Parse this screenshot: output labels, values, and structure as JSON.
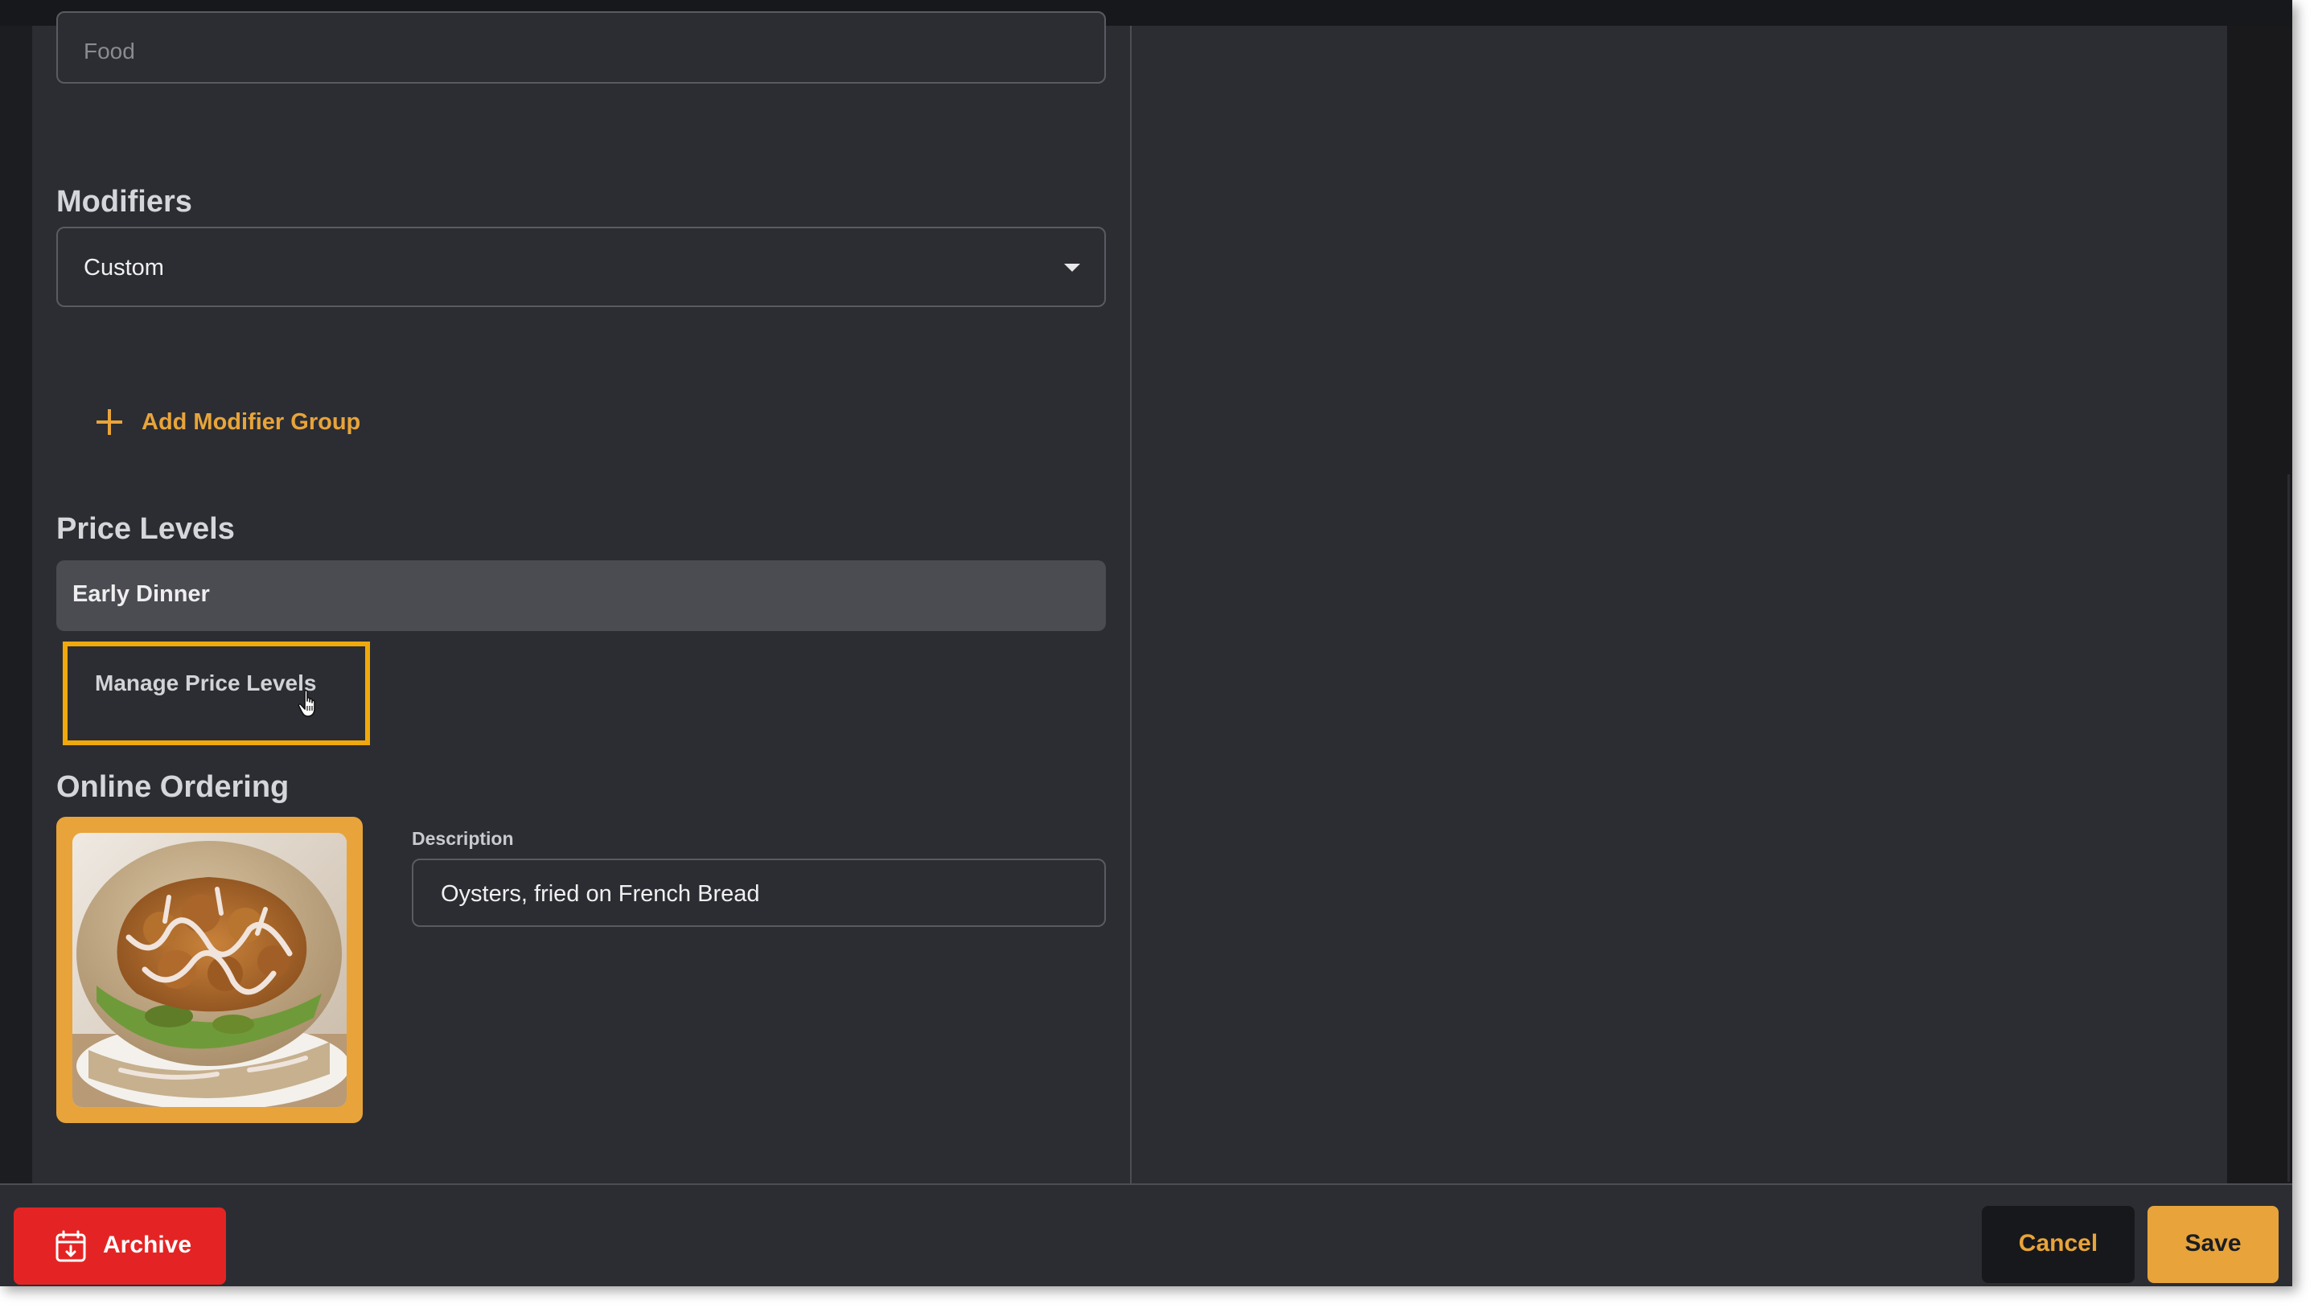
{
  "form": {
    "category": {
      "placeholder": "Food"
    },
    "modifiers": {
      "title": "Modifiers",
      "selected": "Custom",
      "add_group_label": "Add Modifier Group"
    },
    "price_levels": {
      "title": "Price Levels",
      "items": [
        {
          "label": "Early Dinner"
        }
      ],
      "manage_label": "Manage Price Levels"
    },
    "online_ordering": {
      "title": "Online Ordering",
      "description_label": "Description",
      "description_value": "Oysters, fried on French Bread",
      "image_subject": "fried oyster po'boy sandwich"
    }
  },
  "footer": {
    "archive_label": "Archive",
    "cancel_label": "Cancel",
    "save_label": "Save"
  },
  "colors": {
    "accent": "#e8a43a",
    "danger": "#e42424",
    "highlight": "#f0a90c",
    "panel": "#2c2d32"
  },
  "icons": {
    "caret": "chevron-down-icon",
    "add": "plus-icon",
    "archive": "archive-icon",
    "cursor": "hand-pointer-icon"
  }
}
